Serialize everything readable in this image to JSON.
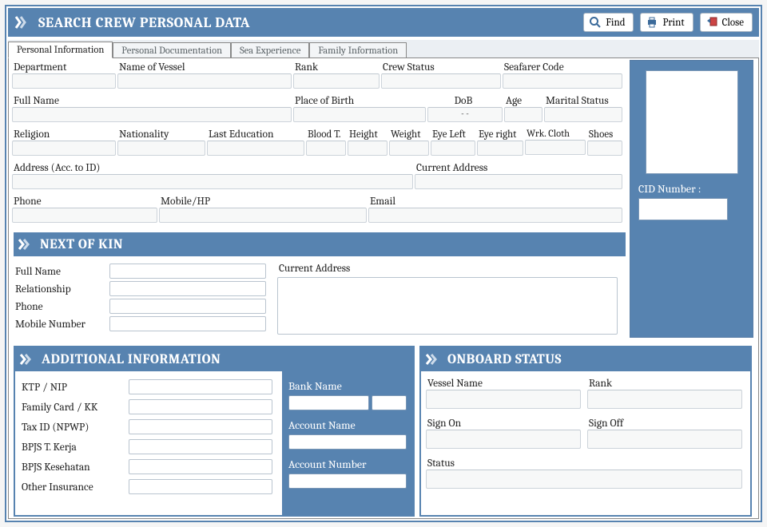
{
  "title": "SEARCH CREW PERSONAL DATA",
  "toolbar": {
    "find": "Find",
    "print": "Print",
    "close": "Close"
  },
  "tabs": {
    "personal_info": "Personal Information",
    "documentation": "Personal Documentation",
    "sea_exp": "Sea Experience",
    "family_info": "Family Information"
  },
  "personal": {
    "department": "Department",
    "vessel": "Name of Vessel",
    "rank": "Rank",
    "crew_status": "Crew Status",
    "seafarer_code": "Seafarer Code",
    "full_name": "Full Name",
    "pob": "Place of Birth",
    "dob": "DoB",
    "dob_value": "- -",
    "age": "Age",
    "marital": "Marital Status",
    "religion": "Religion",
    "nationality": "Nationality",
    "last_edu": "Last Education",
    "blood": "Blood T.",
    "height": "Height",
    "weight": "Weight",
    "eye_left": "Eye Left",
    "eye_right": "Eye right",
    "wrk_cloth": "Wrk. Cloth",
    "shoes": "Shoes",
    "address_id": "Address (Acc. to ID)",
    "cur_address": "Current Address",
    "phone": "Phone",
    "mobile": "Mobile/HP",
    "email": "Email",
    "cid_label": "CID Number :"
  },
  "nok": {
    "title": "NEXT OF KIN",
    "full_name": "Full Name",
    "relation": "Relationship",
    "phone": "Phone",
    "mobile": "Mobile Number",
    "curaddr": "Current Address"
  },
  "addl": {
    "title": "ADDITIONAL INFORMATION",
    "ktp": "KTP / NIP",
    "kk": "Family Card / KK",
    "npwp": "Tax ID (NPWP)",
    "bpjs_tk": "BPJS T. Kerja",
    "bpjs_kes": "BPJS Kesehatan",
    "other_ins": "Other Insurance",
    "bank_name": "Bank Name",
    "acct_name": "Account Name",
    "acct_no": "Account Number"
  },
  "onboard": {
    "title": "ONBOARD STATUS",
    "vessel": "Vessel Name",
    "rank": "Rank",
    "signon": "Sign On",
    "signoff": "Sign Off",
    "status": "Status"
  }
}
